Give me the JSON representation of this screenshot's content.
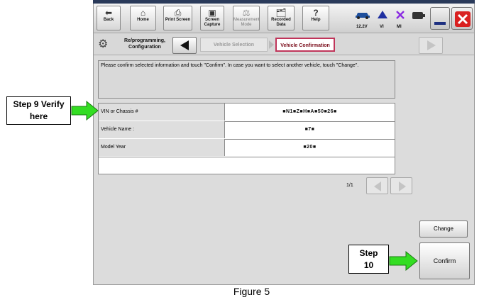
{
  "toolbar": {
    "back": "Back",
    "home": "Home",
    "print_screen": "Print Screen",
    "screen_capture": "Screen\nCapture",
    "measurement_mode": "Measurement\nMode",
    "recorded_data": "Recorded\nData",
    "help": "Help",
    "voltage": "12.2V",
    "vi": "VI",
    "mi": "MI"
  },
  "nav": {
    "mode_label": "Re/programming,\nConfiguration",
    "crumb_previous": "Vehicle Selection",
    "crumb_current": "Vehicle Confirmation"
  },
  "message": "Please confirm selected information and touch \"Confirm\". In case you want to select another vehicle, touch \"Change\".",
  "table": {
    "rows": [
      {
        "label": "VIN or Chassis #",
        "value": "■N1■Z■H■A■50■26■"
      },
      {
        "label": "Vehicle Name :",
        "value": "■7■"
      },
      {
        "label": "Model Year",
        "value": "■20■"
      }
    ]
  },
  "pager": "1/1",
  "buttons": {
    "change": "Change",
    "confirm": "Confirm"
  },
  "callouts": {
    "step9": "Step 9 Verify\nhere",
    "step10": "Step\n10"
  },
  "caption": "Figure 5",
  "colors": {
    "arrow_green": "#33dd22",
    "crumb_active_border": "#c0355a",
    "close_red": "#d92020"
  }
}
